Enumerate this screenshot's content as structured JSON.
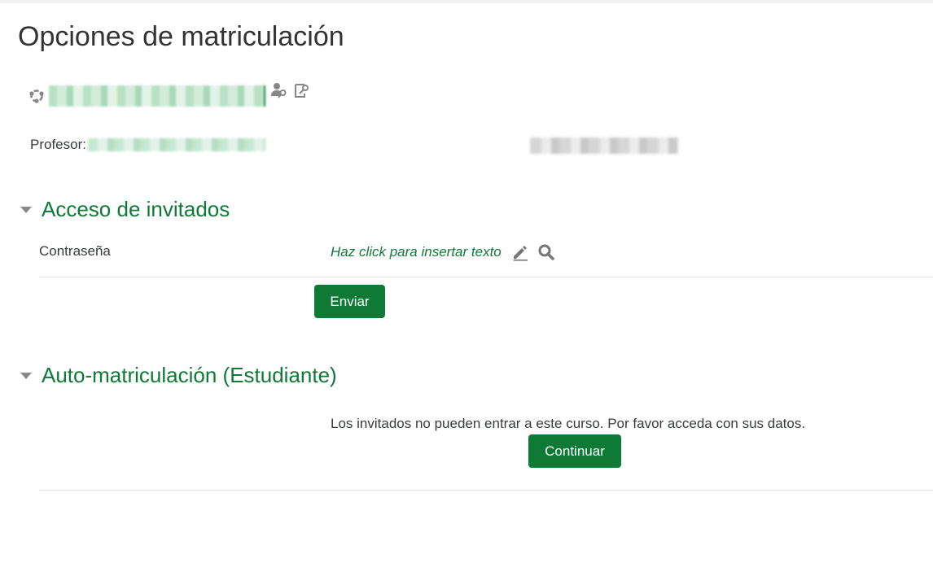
{
  "page": {
    "title": "Opciones de matriculación"
  },
  "course": {
    "teacher_label": "Profesor:"
  },
  "sections": {
    "guest": {
      "heading": "Acceso de invitados",
      "password_label": "Contraseña",
      "inplace_placeholder": "Haz click para insertar texto",
      "submit_label": "Enviar"
    },
    "self": {
      "heading": "Auto-matriculación (Estudiante)",
      "notice": "Los invitados no pueden entrar a este curso. Por favor acceda con sus datos.",
      "continue_label": "Continuar"
    }
  },
  "icons": {
    "course": "course-network-icon",
    "enrol_key": "user-key-icon",
    "guest_key": "key-edit-icon",
    "edit": "pencil-icon",
    "reveal": "search-icon"
  },
  "colors": {
    "accent": "#0f7a35",
    "text": "#373a3c",
    "muted_icon": "#777777"
  }
}
